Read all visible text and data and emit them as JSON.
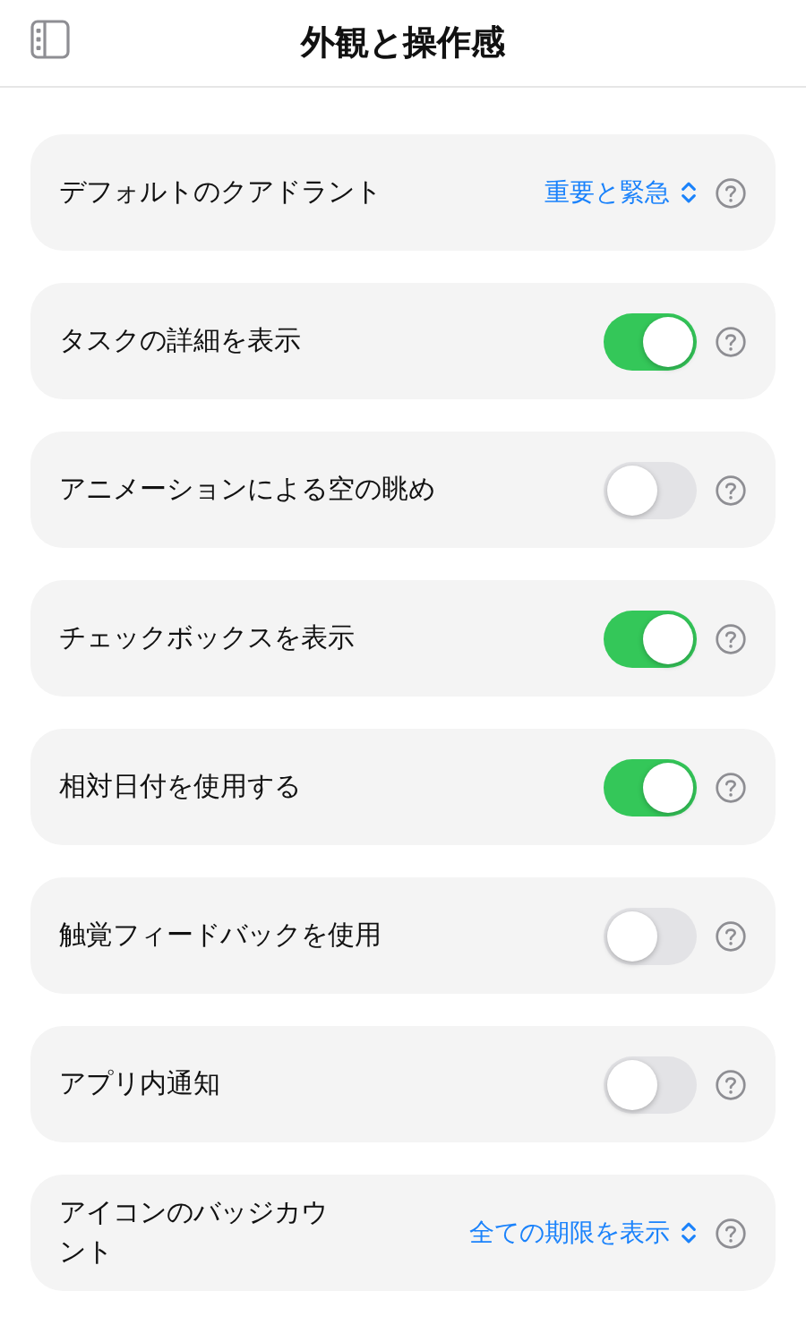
{
  "header": {
    "title": "外観と操作感"
  },
  "settings": [
    {
      "kind": "picker",
      "label": "デフォルトのクアドラント",
      "value": "重要と緊急"
    },
    {
      "kind": "toggle",
      "label": "タスクの詳細を表示",
      "on": true
    },
    {
      "kind": "toggle",
      "label": "アニメーションによる空の眺め",
      "on": false
    },
    {
      "kind": "toggle",
      "label": "チェックボックスを表示",
      "on": true
    },
    {
      "kind": "toggle",
      "label": "相対日付を使用する",
      "on": true
    },
    {
      "kind": "toggle",
      "label": "触覚フィードバックを使用",
      "on": false
    },
    {
      "kind": "toggle",
      "label": "アプリ内通知",
      "on": false
    },
    {
      "kind": "picker",
      "label": "アイコンのバッジカウント",
      "value": "全ての期限を表示"
    }
  ]
}
